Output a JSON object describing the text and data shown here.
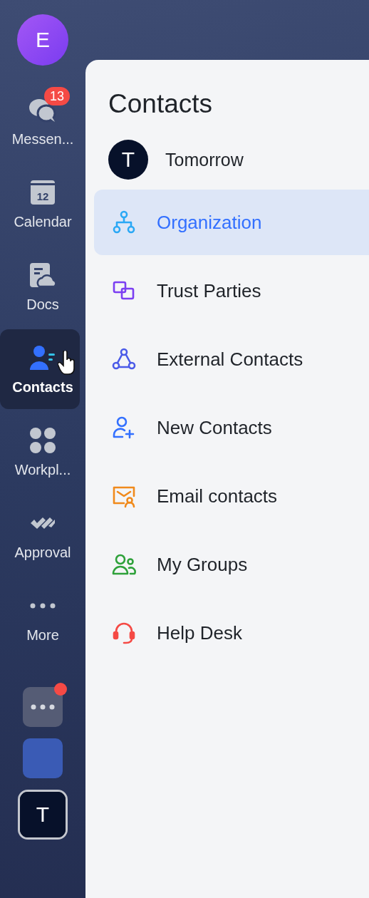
{
  "user_avatar": {
    "initial": "E"
  },
  "nav": [
    {
      "kind": "chat",
      "label": "Messen...",
      "selected": false,
      "badge": "13"
    },
    {
      "kind": "calendar",
      "label": "Calendar",
      "selected": false,
      "day": "12"
    },
    {
      "kind": "docs",
      "label": "Docs",
      "selected": false
    },
    {
      "kind": "contacts",
      "label": "Contacts",
      "selected": true
    },
    {
      "kind": "workplace",
      "label": "Workpl...",
      "selected": false
    },
    {
      "kind": "approval",
      "label": "Approval",
      "selected": false
    },
    {
      "kind": "more",
      "label": "More",
      "selected": false
    }
  ],
  "bottom_apps": [
    {
      "kind": "dots",
      "dot": true
    },
    {
      "kind": "blank"
    },
    {
      "kind": "avatar",
      "initial": "T"
    }
  ],
  "panel": {
    "title": "Contacts",
    "org": {
      "initial": "T",
      "name": "Tomorrow"
    },
    "items": [
      {
        "kind": "org",
        "label": "Organization",
        "color": "#2aa8f5",
        "selected": true
      },
      {
        "kind": "trust",
        "label": "Trust Parties",
        "color": "#7b3ff2",
        "selected": false
      },
      {
        "kind": "external",
        "label": "External Contacts",
        "color": "#4a5ae8",
        "selected": false
      },
      {
        "kind": "new",
        "label": "New Contacts",
        "color": "#3370ff",
        "selected": false
      },
      {
        "kind": "email",
        "label": "Email contacts",
        "color": "#f08a1c",
        "selected": false
      },
      {
        "kind": "groups",
        "label": "My Groups",
        "color": "#2ea13a",
        "selected": false
      },
      {
        "kind": "help",
        "label": "Help Desk",
        "color": "#f54a45",
        "selected": false
      }
    ]
  }
}
